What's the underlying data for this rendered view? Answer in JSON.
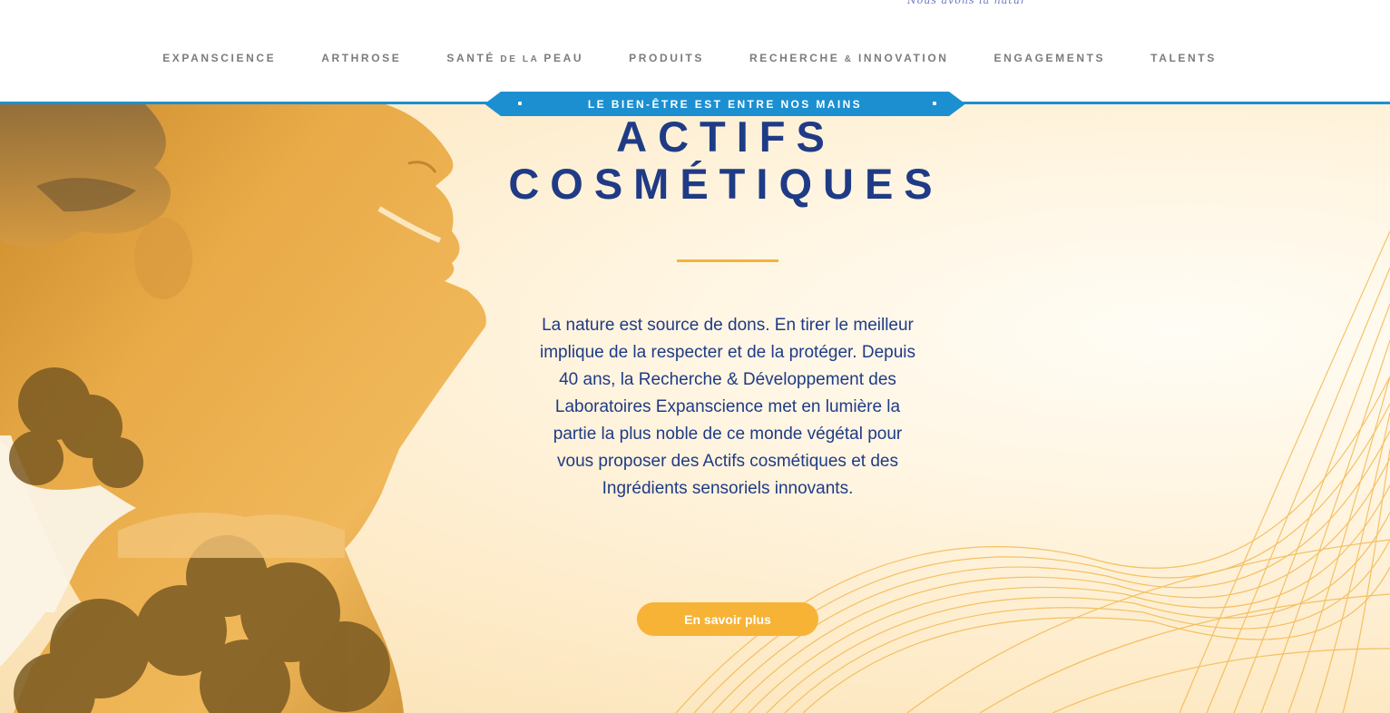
{
  "logo": {
    "tagline": "Nous avons la nature en héritage"
  },
  "nav": {
    "items": [
      {
        "label": "EXPANSCIENCE"
      },
      {
        "label": "ARTHROSE"
      },
      {
        "label_a": "SANTÉ",
        "label_b": " DE LA ",
        "label_c": "PEAU"
      },
      {
        "label": "PRODUITS"
      },
      {
        "label_a": "RECHERCHE",
        "label_b": " & ",
        "label_c": "INNOVATION"
      },
      {
        "label": "ENGAGEMENTS"
      },
      {
        "label": "TALENTS"
      }
    ]
  },
  "banner": {
    "text": "LE BIEN-ÊTRE EST ENTRE NOS MAINS"
  },
  "hero": {
    "title_line1": "ACTIFS",
    "title_line2": "COSMÉTIQUES",
    "description": "La nature est source de dons. En tirer le meilleur implique de la respecter et de la protéger. Depuis 40 ans, la Recherche & Développement des Laboratoires Expanscience met en lumière la partie la plus noble de ce monde végétal pour vous proposer des Actifs cosmétiques et des Ingrédients sensoriels innovants.",
    "cta_label": "En savoir plus"
  },
  "colors": {
    "brand_blue": "#1f3b86",
    "accent_blue": "#1c8fd0",
    "accent_gold": "#f7b335",
    "nav_gray": "#7c7c7c"
  }
}
